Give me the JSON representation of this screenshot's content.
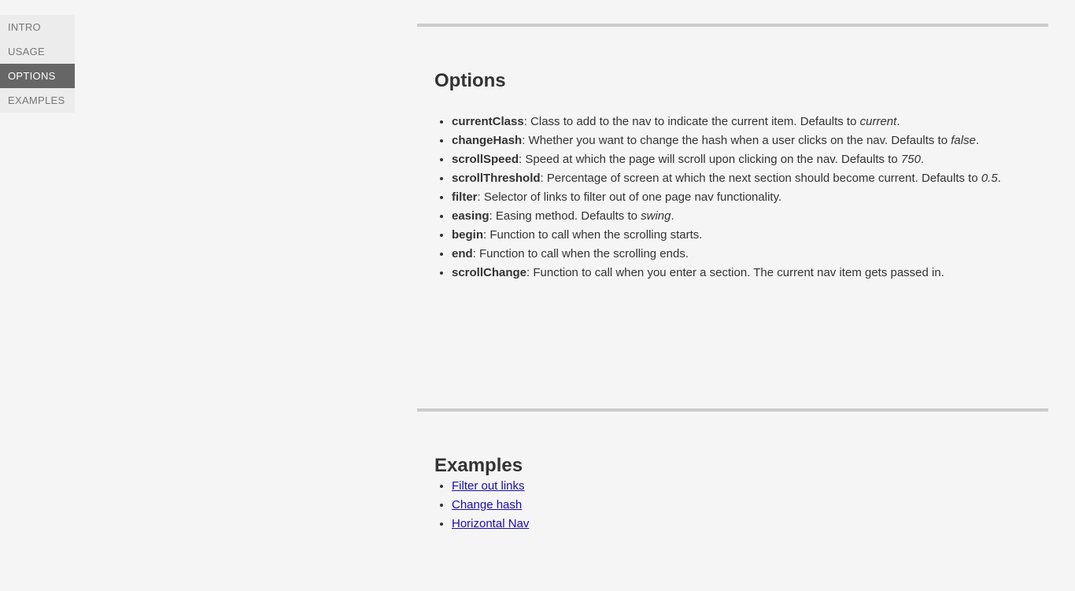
{
  "sidebar": {
    "items": [
      {
        "label": "INTRO",
        "current": false
      },
      {
        "label": "USAGE",
        "current": false
      },
      {
        "label": "OPTIONS",
        "current": true
      },
      {
        "label": "EXAMPLES",
        "current": false
      }
    ]
  },
  "sections": {
    "options": {
      "heading": "Options",
      "items": [
        {
          "name": "currentClass",
          "desc": ": Class to add to the nav to indicate the current item. Defaults to ",
          "default": "current",
          "tail": "."
        },
        {
          "name": "changeHash",
          "desc": ": Whether you want to change the hash when a user clicks on the nav. Defaults to ",
          "default": "false",
          "tail": "."
        },
        {
          "name": "scrollSpeed",
          "desc": ": Speed at which the page will scroll upon clicking on the nav. Defaults to ",
          "default": "750",
          "tail": "."
        },
        {
          "name": "scrollThreshold",
          "desc": ": Percentage of screen at which the next section should become current. Defaults to ",
          "default": "0.5",
          "tail": "."
        },
        {
          "name": "filter",
          "desc": ": Selector of links to filter out of one page nav functionality.",
          "default": "",
          "tail": ""
        },
        {
          "name": "easing",
          "desc": ": Easing method. Defaults to ",
          "default": "swing",
          "tail": "."
        },
        {
          "name": "begin",
          "desc": ": Function to call when the scrolling starts.",
          "default": "",
          "tail": ""
        },
        {
          "name": "end",
          "desc": ": Function to call when the scrolling ends.",
          "default": "",
          "tail": ""
        },
        {
          "name": "scrollChange",
          "desc": ": Function to call when you enter a section. The current nav item gets passed in.",
          "default": "",
          "tail": ""
        }
      ]
    },
    "examples": {
      "heading": "Examples",
      "links": [
        {
          "label": "Filter out links"
        },
        {
          "label": "Change hash"
        },
        {
          "label": "Horizontal Nav"
        }
      ]
    }
  }
}
